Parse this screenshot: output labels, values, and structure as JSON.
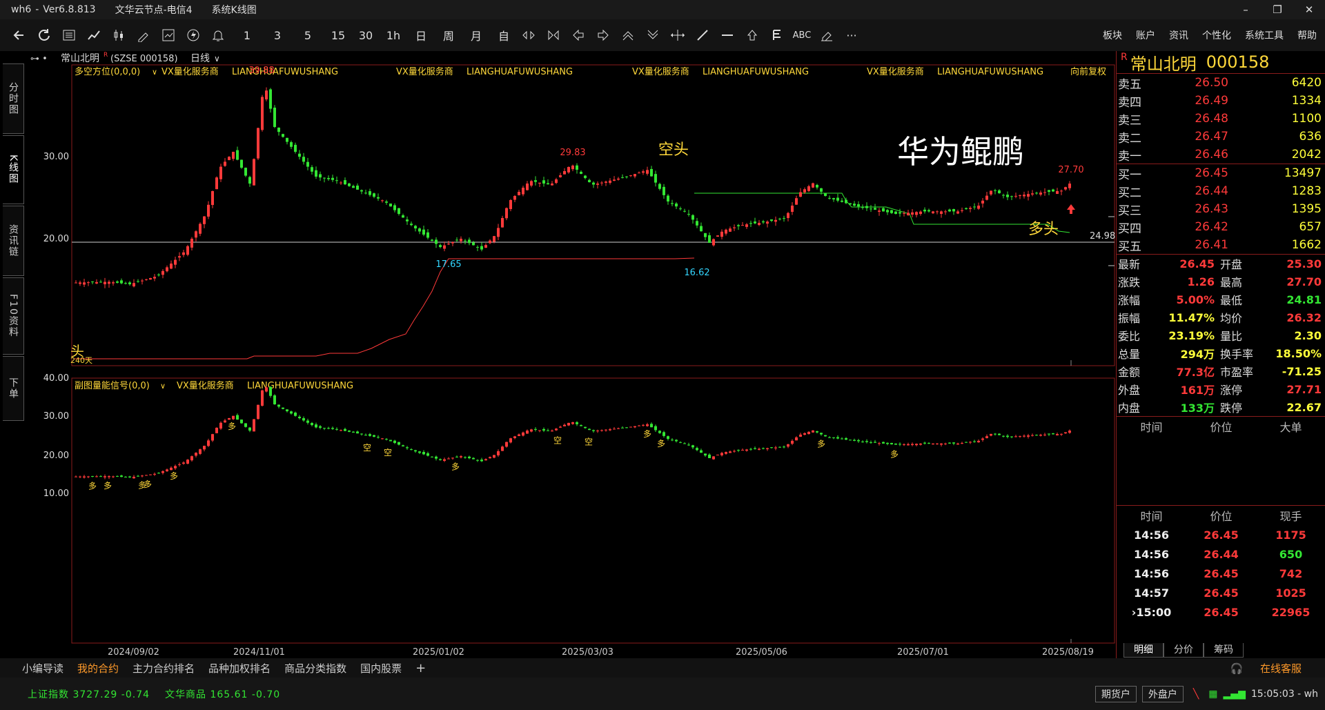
{
  "window": {
    "app": "wh6",
    "version": "Ver6.8.813",
    "server": "文华云节点-电信4",
    "module": "系统K线图",
    "minimize": "–",
    "maximize": "❐",
    "close": "✕"
  },
  "toolbar": {
    "periods": [
      "1",
      "3",
      "5",
      "15",
      "30",
      "1h",
      "日",
      "周",
      "月",
      "自"
    ],
    "right_menu": [
      "板块",
      "账户",
      "资讯",
      "个性化",
      "系统工具",
      "帮助"
    ],
    "abc": "ABC",
    "more": "···"
  },
  "left_tabs": [
    "分时图",
    "K线图",
    "资讯链",
    "F10资料",
    "下单"
  ],
  "chart_header": {
    "symbol": "常山北明",
    "symbol_code": "(SZSE 000158)",
    "period": "日线",
    "main_indicator": "多空方位(0,0,0)",
    "vx_label": "VX量化服务商",
    "vx_code": "LIANGHUAFUWUSHANG",
    "adjust": "向前复权",
    "sub_indicator": "副图量能信号(0,0)"
  },
  "annotations": {
    "kongtou": "空头",
    "duotou": "多头",
    "huawei": "华为鲲鹏",
    "tou": "头",
    "days": "240天",
    "kong_char": "空",
    "duo_char": "多"
  },
  "colors": {
    "up": "#ff3a3a",
    "down": "#33e633",
    "accent": "#ffd83a",
    "frame": "#8a1c1c"
  },
  "chart_data": [
    {
      "type": "candlestick",
      "title": "多空方位(0,0,0)",
      "x_ticks": [
        "2024/09/02",
        "2024/11/01",
        "2025/01/02",
        "2025/03/03",
        "2025/05/06",
        "2025/07/01",
        "2025/08/19"
      ],
      "y_ticks": [
        "30.00",
        "20.00"
      ],
      "price_labels": [
        {
          "label": "39.88",
          "date": "2024/11/07",
          "value": 39.88
        },
        {
          "label": "29.83",
          "date": "2025/02/27",
          "value": 29.83
        },
        {
          "label": "17.65",
          "date": "2025/01/13",
          "value": 17.65
        },
        {
          "label": "16.62",
          "date": "2025/04/07",
          "value": 16.62
        },
        {
          "label": "27.70",
          "date": "2025/08/19",
          "value": 27.7
        }
      ],
      "current_price_label": "24.98",
      "current_price": 24.98
    },
    {
      "type": "candlestick",
      "title": "副图量能信号(0,0)",
      "y_ticks": [
        "40.00",
        "30.00",
        "20.00",
        "10.00"
      ]
    }
  ],
  "quote": {
    "name": "常山北明",
    "code": "000158",
    "flag": "R",
    "asks": [
      {
        "label": "卖五",
        "price": "26.50",
        "vol": "6420"
      },
      {
        "label": "卖四",
        "price": "26.49",
        "vol": "1334"
      },
      {
        "label": "卖三",
        "price": "26.48",
        "vol": "1100"
      },
      {
        "label": "卖二",
        "price": "26.47",
        "vol": "636"
      },
      {
        "label": "卖一",
        "price": "26.46",
        "vol": "2042"
      }
    ],
    "bids": [
      {
        "label": "买一",
        "price": "26.45",
        "vol": "13497"
      },
      {
        "label": "买二",
        "price": "26.44",
        "vol": "1283"
      },
      {
        "label": "买三",
        "price": "26.43",
        "vol": "1395"
      },
      {
        "label": "买四",
        "price": "26.42",
        "vol": "657"
      },
      {
        "label": "买五",
        "price": "26.41",
        "vol": "1662"
      }
    ],
    "stats": [
      {
        "k1": "最新",
        "v1": "26.45",
        "c1": "red",
        "k2": "开盘",
        "v2": "25.30",
        "c2": "red"
      },
      {
        "k1": "涨跌",
        "v1": "1.26",
        "c1": "red",
        "k2": "最高",
        "v2": "27.70",
        "c2": "red"
      },
      {
        "k1": "涨幅",
        "v1": "5.00%",
        "c1": "red",
        "k2": "最低",
        "v2": "24.81",
        "c2": "green"
      },
      {
        "k1": "振幅",
        "v1": "11.47%",
        "c1": "yellow",
        "k2": "均价",
        "v2": "26.32",
        "c2": "red"
      },
      {
        "k1": "委比",
        "v1": "23.19%",
        "c1": "yellow",
        "k2": "量比",
        "v2": "2.30",
        "c2": "yellow"
      },
      {
        "k1": "总量",
        "v1": "294万",
        "c1": "yellow",
        "k2": "换手率",
        "v2": "18.50%",
        "c2": "yellow"
      },
      {
        "k1": "金额",
        "v1": "77.3亿",
        "c1": "red",
        "k2": "市盈率",
        "v2": "-71.25",
        "c2": "yellow"
      },
      {
        "k1": "外盘",
        "v1": "161万",
        "c1": "red",
        "k2": "涨停",
        "v2": "27.71",
        "c2": "red"
      },
      {
        "k1": "内盘",
        "v1": "133万",
        "c1": "green",
        "k2": "跌停",
        "v2": "22.67",
        "c2": "yellow"
      }
    ],
    "big_header": [
      "时间",
      "价位",
      "大单"
    ],
    "tick_header": [
      "时间",
      "价位",
      "现手"
    ],
    "ticks": [
      {
        "t": "14:56",
        "p": "26.45",
        "v": "1175",
        "vc": "red"
      },
      {
        "t": "14:56",
        "p": "26.44",
        "v": "650",
        "vc": "green"
      },
      {
        "t": "14:56",
        "p": "26.45",
        "v": "742",
        "vc": "red"
      },
      {
        "t": "14:57",
        "p": "26.45",
        "v": "1025",
        "vc": "red"
      },
      {
        "t": "›15:00",
        "p": "26.45",
        "v": "22965",
        "vc": "red"
      }
    ],
    "tabs": [
      "明细",
      "分价",
      "筹码"
    ]
  },
  "bottom_tabs": [
    "小编导读",
    "我的合约",
    "主力合约排名",
    "品种加权排名",
    "商品分类指数",
    "国内股票"
  ],
  "bottom_add": "+",
  "service": "在线客服",
  "status": {
    "idx1": "上证指数  3727.29  -0.74",
    "idx2": "文华商品  165.61  -0.70",
    "btn1": "期货户",
    "btn2": "外盘户",
    "time": "15:05:03 - wh"
  }
}
